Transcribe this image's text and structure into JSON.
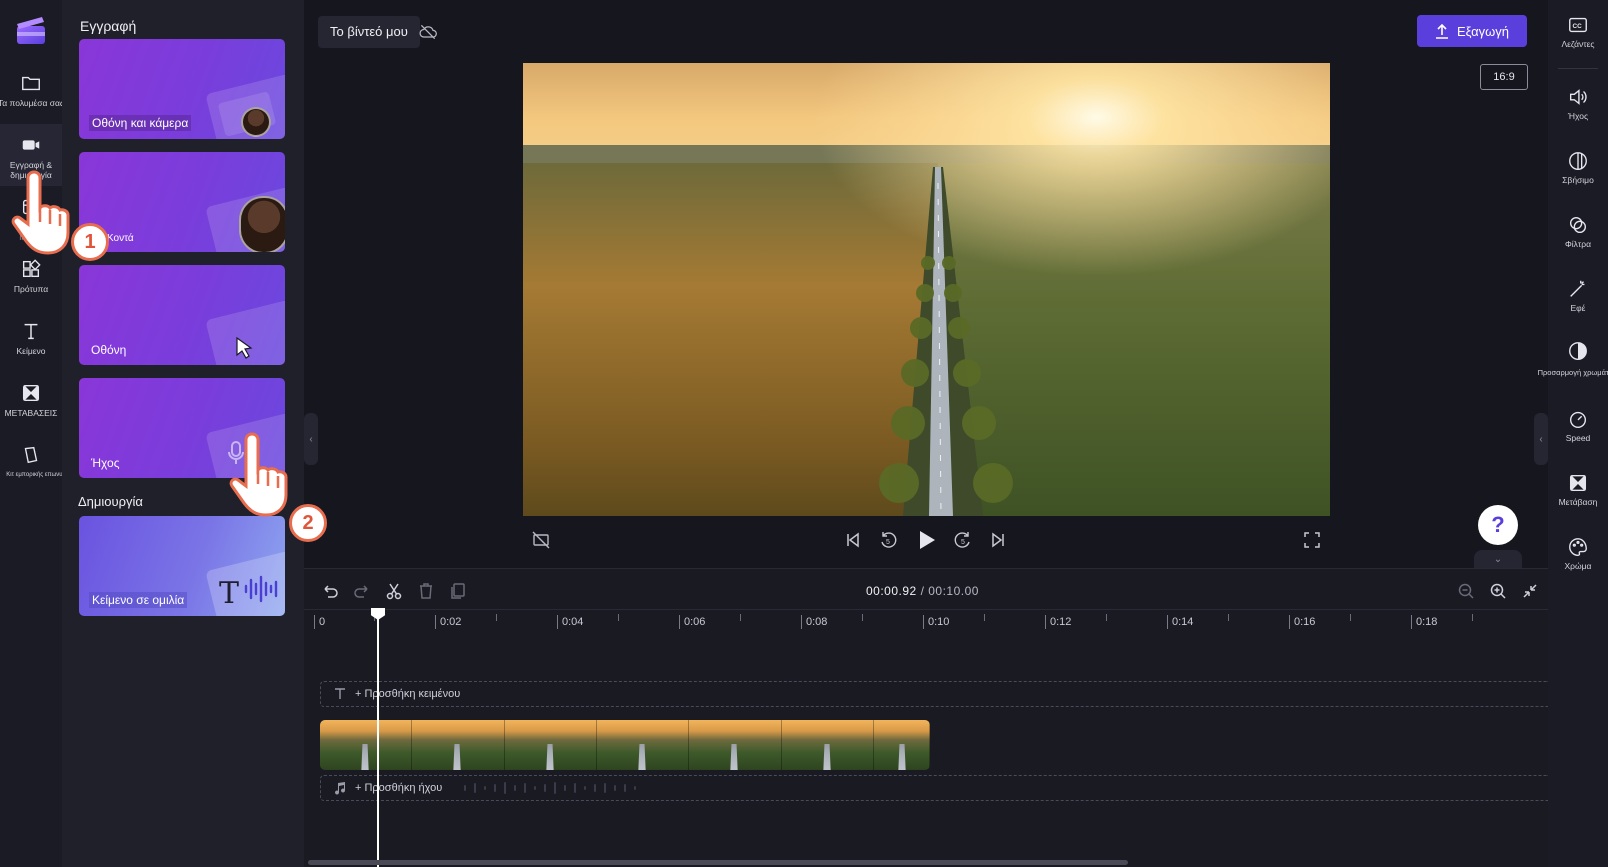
{
  "left_rail": {
    "items": [
      {
        "label": "Τα πολυμέσα σας",
        "icon": "folder-icon"
      },
      {
        "label": "Εγγραφή & δημιουργία",
        "icon": "video-camera-icon"
      },
      {
        "label": "Content library",
        "icon": "library-icon"
      },
      {
        "label": "Πρότυπα",
        "icon": "templates-icon"
      },
      {
        "label": "Κείμενο",
        "icon": "text-icon"
      },
      {
        "label": "ΜΕΤΑΒΑΣΕΙΣ",
        "icon": "transitions-icon"
      },
      {
        "label": "Κιτ εμπορικής επωνυμίας",
        "icon": "brand-kit-icon"
      }
    ]
  },
  "panel": {
    "record_heading": "Εγγραφή",
    "record_cards": [
      {
        "label": "Οθόνη και κάμερα"
      },
      {
        "label": "Κοντά"
      },
      {
        "label": "Οθόνη"
      },
      {
        "label": "Ήχος"
      }
    ],
    "create_heading": "Δημιουργία",
    "create_cards": [
      {
        "label": "Κείμενο σε ομιλία"
      }
    ]
  },
  "topbar": {
    "project_title": "Το βίντεό μου",
    "export_label": "Εξαγωγή",
    "aspect_ratio": "16:9"
  },
  "help": {
    "label": "?"
  },
  "right_rail": {
    "items": [
      {
        "label": "Λεζάντες",
        "icon": "captions-icon"
      },
      {
        "label": "Ήχος",
        "icon": "speaker-icon"
      },
      {
        "label": "Σβήσιμο",
        "icon": "fade-icon"
      },
      {
        "label": "Φίλτρα",
        "icon": "filters-icon"
      },
      {
        "label": "Εφέ",
        "icon": "magic-wand-icon"
      },
      {
        "label": "Προσαρμογή χρωμάτων",
        "icon": "contrast-icon"
      },
      {
        "label": "Speed",
        "icon": "speedometer-icon"
      },
      {
        "label": "Μετάβαση",
        "icon": "transition-icon"
      },
      {
        "label": "Χρώμα",
        "icon": "palette-icon"
      }
    ]
  },
  "timeline": {
    "current_time": "00:00.92",
    "total_time": "00:10.00",
    "ruler": [
      "0",
      "0:02",
      "0:04",
      "0:06",
      "0:08",
      "0:10",
      "0:12",
      "0:14",
      "0:16",
      "0:18"
    ],
    "text_track": "+ Προσθήκη κειμένου",
    "audio_track": "+ Προσθήκη ήχου",
    "clip_frames": 7
  },
  "tutorial": {
    "step1": "1",
    "step2": "2"
  },
  "colors": {
    "accent": "#5b3fdc",
    "background": "#16161f",
    "callout": "#e86d4e"
  }
}
